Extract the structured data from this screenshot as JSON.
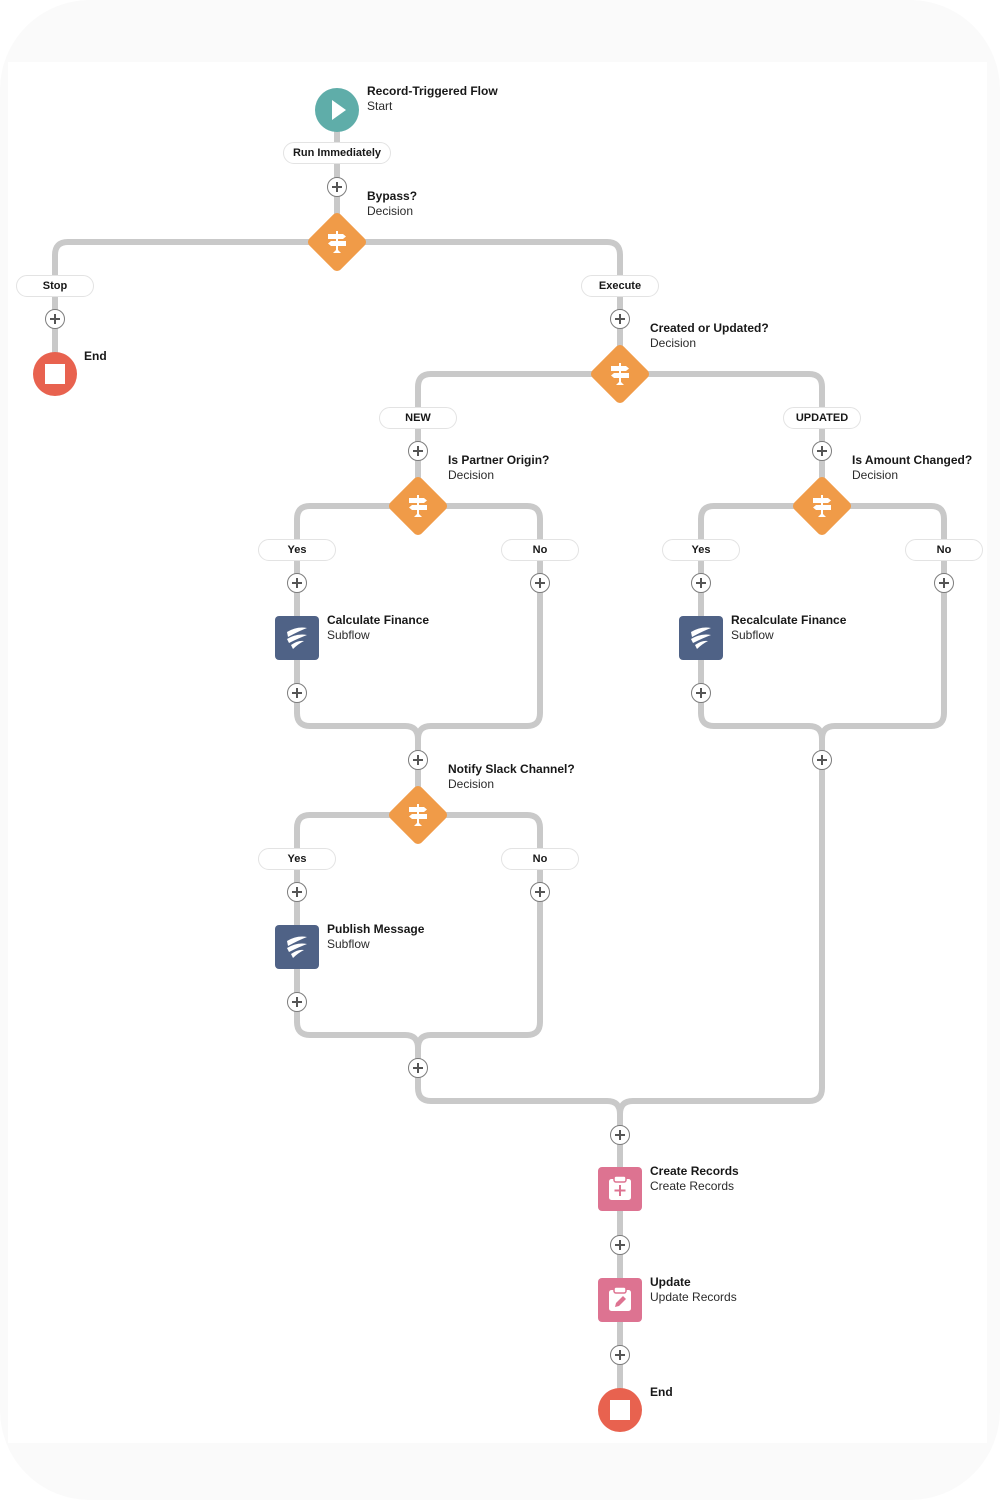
{
  "flow": {
    "start": {
      "title": "Record-Triggered Flow",
      "subtitle": "Start",
      "icon": "play-icon",
      "color": "#5fada9"
    },
    "run_label": "Run Immediately",
    "decisions": [
      {
        "id": "bypass",
        "title": "Bypass?",
        "subtitle": "Decision",
        "outcomes": [
          "Stop",
          "Execute"
        ]
      },
      {
        "id": "created_or_updated",
        "title": "Created or Updated?",
        "subtitle": "Decision",
        "outcomes": [
          "NEW",
          "UPDATED"
        ]
      },
      {
        "id": "is_partner_origin",
        "title": "Is Partner Origin?",
        "subtitle": "Decision",
        "outcomes": [
          "Yes",
          "No"
        ]
      },
      {
        "id": "is_amount_changed",
        "title": "Is Amount Changed?",
        "subtitle": "Decision",
        "outcomes": [
          "Yes",
          "No"
        ]
      },
      {
        "id": "notify_slack",
        "title": "Notify Slack Channel?",
        "subtitle": "Decision",
        "outcomes": [
          "Yes",
          "No"
        ]
      }
    ],
    "subflows": [
      {
        "title": "Calculate Finance",
        "subtitle": "Subflow"
      },
      {
        "title": "Recalculate Finance",
        "subtitle": "Subflow"
      },
      {
        "title": "Publish Message",
        "subtitle": "Subflow"
      }
    ],
    "records": [
      {
        "title": "Create Records",
        "subtitle": "Create Records",
        "icon": "clipboard-plus-icon"
      },
      {
        "title": "Update",
        "subtitle": "Update Records",
        "icon": "clipboard-edit-icon"
      }
    ],
    "ends": [
      {
        "title": "End"
      },
      {
        "title": "End"
      }
    ]
  },
  "colors": {
    "start": "#5fada9",
    "decision": "#f09b48",
    "subflow": "#4f6286",
    "record": "#dd7391",
    "end": "#e8624f",
    "connector": "#c9c9c9"
  }
}
